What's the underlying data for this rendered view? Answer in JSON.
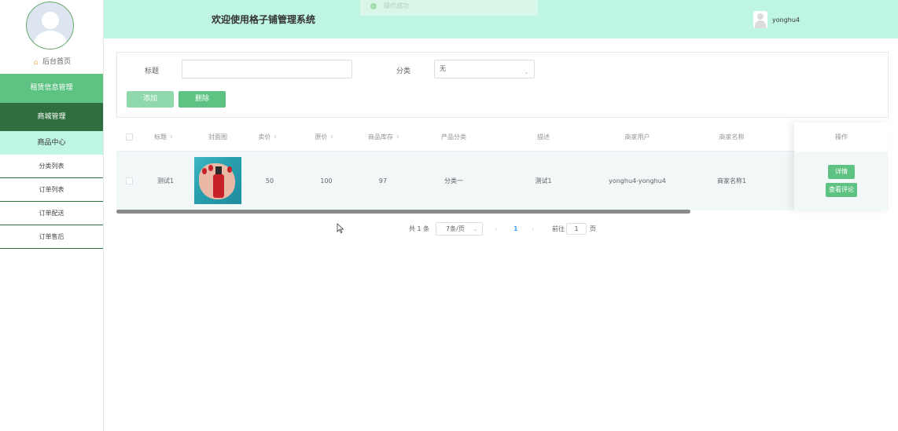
{
  "header": {
    "title": "欢迎使用格子铺管理系统",
    "toast": "操作成功",
    "user_name": "yonghu4"
  },
  "sidebar": {
    "home_label": "后台首页",
    "menu": {
      "rental": "租赁信息管理",
      "mall": "商城管理",
      "center": "商品中心"
    },
    "sub_items": [
      "分类列表",
      "订单列表",
      "订单配送",
      "订单售后"
    ]
  },
  "search": {
    "title_label": "标题",
    "title_value": "",
    "category_label": "分类",
    "category_value": "无",
    "add_label": "添加",
    "delete_label": "删除"
  },
  "table": {
    "headers": {
      "title": "标题",
      "cover": "封面图",
      "price": "卖价",
      "original_price": "原价",
      "stock": "商品库存",
      "category": "产品分类",
      "description": "描述",
      "merchant_user": "商家用户",
      "merchant_name": "商家名称",
      "actions": "操作"
    },
    "rows": [
      {
        "title": "测试1",
        "price": "50",
        "original_price": "100",
        "stock": "97",
        "category": "分类一",
        "description": "测试1",
        "merchant_user": "yonghu4-yonghu4",
        "merchant_name": "商家名称1",
        "detail_label": "详情",
        "comments_label": "查看评论"
      }
    ]
  },
  "pagination": {
    "total": "共 1 条",
    "page_size": "7条/页",
    "current_page": "1",
    "goto_label": "前往",
    "goto_value": "1",
    "page_suffix": "页"
  },
  "colors": {
    "header_bg": "#bff5e3",
    "primary": "#5ec382",
    "dark_green": "#2f6e3e",
    "active_page": "#409eff"
  },
  "icons": {
    "home": "home-icon",
    "sort": "sort-caret-icon",
    "select": "chevron-down-icon",
    "prev": "chevron-left-icon",
    "next": "chevron-right-icon"
  }
}
